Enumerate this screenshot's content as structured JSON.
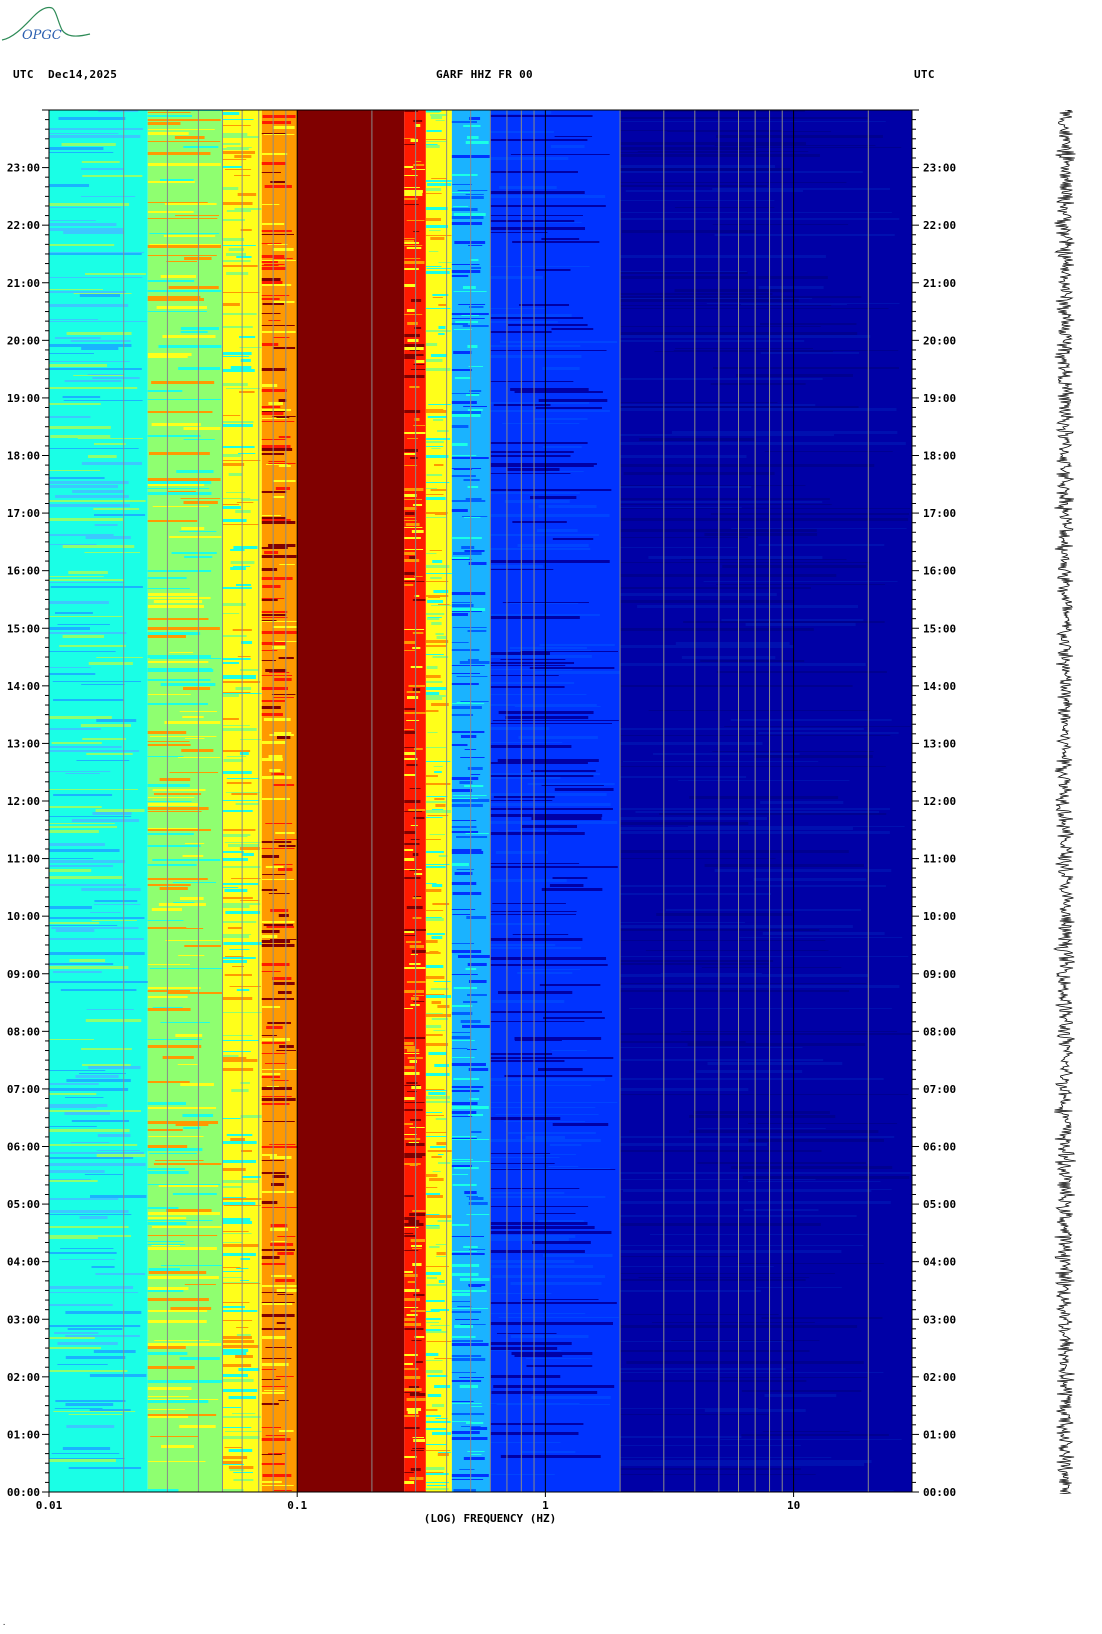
{
  "header": {
    "tz_left": "UTC",
    "date": "Dec14,2025",
    "station": "GARF HHZ FR 00",
    "tz_right": "UTC"
  },
  "logo": {
    "text": "OPGC"
  },
  "footer_mark": "·",
  "colors": {
    "darkred": "#800000",
    "red": "#ff1a00",
    "orange": "#ff9900",
    "yellow": "#ffff1a",
    "green": "#8fff70",
    "cyan": "#1affe6",
    "lightblue": "#1ab3ff",
    "blue": "#0033ff",
    "darkblue": "#0000a6",
    "navy": "#000090"
  },
  "chart_data": {
    "type": "heatmap",
    "title": "GARF HHZ FR 00",
    "xlabel": "(LOG) FREQUENCY (HZ)",
    "ylabel": "UTC",
    "xscale": "log",
    "xlim": [
      0.01,
      30
    ],
    "x_ticks": [
      "0.01",
      "0.1",
      "1",
      "10"
    ],
    "ylim": [
      0,
      24
    ],
    "y_ticks": [
      "00:00",
      "01:00",
      "02:00",
      "03:00",
      "04:00",
      "05:00",
      "06:00",
      "07:00",
      "08:00",
      "09:00",
      "10:00",
      "11:00",
      "12:00",
      "13:00",
      "14:00",
      "15:00",
      "16:00",
      "17:00",
      "18:00",
      "19:00",
      "20:00",
      "21:00",
      "22:00",
      "23:00"
    ],
    "frequency_bands_hz": [
      {
        "from": 0.01,
        "to": 0.025,
        "level": "cyan"
      },
      {
        "from": 0.025,
        "to": 0.05,
        "level": "yellow-green"
      },
      {
        "from": 0.05,
        "to": 0.072,
        "level": "yellow"
      },
      {
        "from": 0.072,
        "to": 0.1,
        "level": "orange-red"
      },
      {
        "from": 0.1,
        "to": 0.27,
        "level": "dark red"
      },
      {
        "from": 0.27,
        "to": 0.33,
        "level": "red-orange"
      },
      {
        "from": 0.33,
        "to": 0.42,
        "level": "yellow-cyan"
      },
      {
        "from": 0.42,
        "to": 0.6,
        "level": "light blue"
      },
      {
        "from": 0.6,
        "to": 2.0,
        "level": "blue"
      },
      {
        "from": 2.0,
        "to": 30,
        "level": "dark blue"
      }
    ],
    "grid": true
  }
}
